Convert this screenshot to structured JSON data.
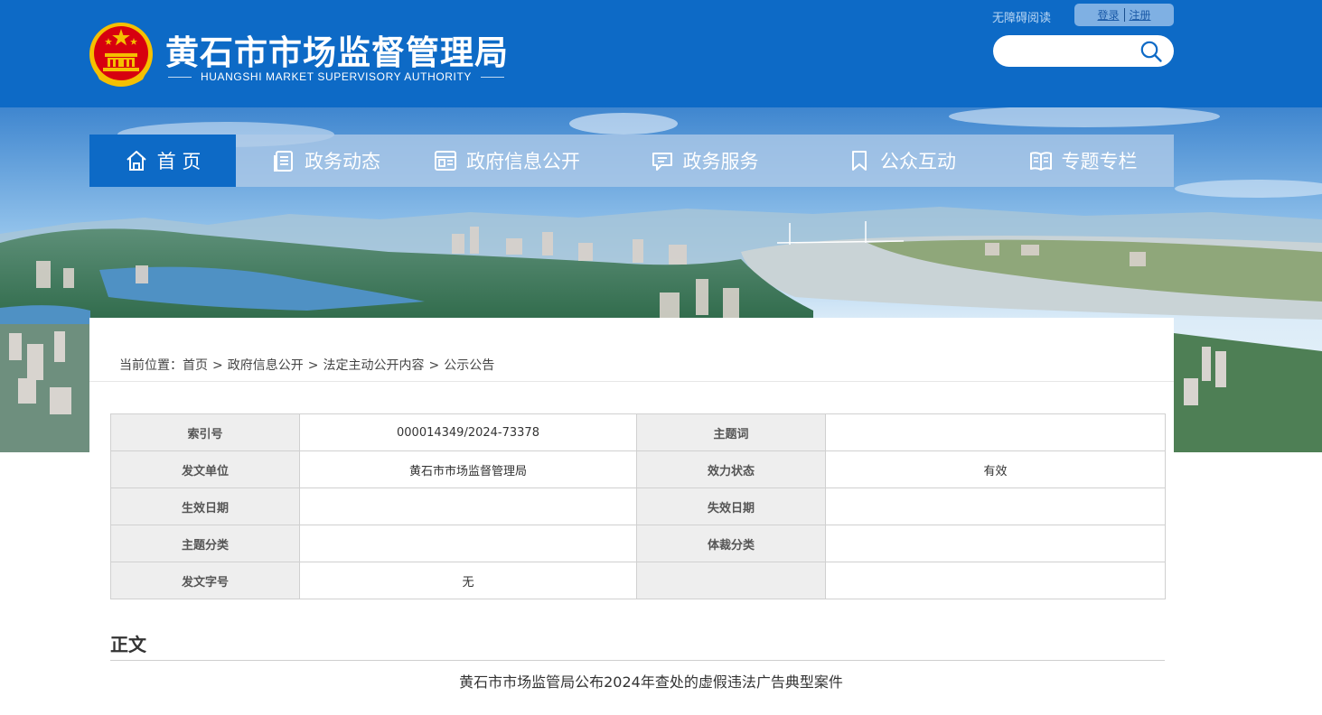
{
  "header": {
    "title": "黄石市市场监督管理局",
    "subtitle": "HUANGSHI MARKET SUPERVISORY AUTHORITY",
    "accessibility_label": "无障碍阅读",
    "login_label": "登录",
    "register_label": "注册",
    "search_placeholder": ""
  },
  "nav": {
    "items": [
      {
        "label": "首 页",
        "icon": "home-icon",
        "active": true
      },
      {
        "label": "政务动态",
        "icon": "document-list-icon"
      },
      {
        "label": "政府信息公开",
        "icon": "info-board-icon"
      },
      {
        "label": "政务服务",
        "icon": "chat-bubble-icon"
      },
      {
        "label": "公众互动",
        "icon": "bookmark-icon"
      },
      {
        "label": "专题专栏",
        "icon": "open-book-icon"
      }
    ]
  },
  "breadcrumb": {
    "prefix": "当前位置：",
    "items": [
      "首页",
      "政府信息公开",
      "法定主动公开内容",
      "公示公告"
    ],
    "separator": ">"
  },
  "meta_table": {
    "rows": [
      [
        {
          "label": "索引号",
          "value": "000014349/2024-73378"
        },
        {
          "label": "主题词",
          "value": ""
        }
      ],
      [
        {
          "label": "发文单位",
          "value": "黄石市市场监督管理局"
        },
        {
          "label": "效力状态",
          "value": "有效"
        }
      ],
      [
        {
          "label": "生效日期",
          "value": ""
        },
        {
          "label": "失效日期",
          "value": ""
        }
      ],
      [
        {
          "label": "主题分类",
          "value": ""
        },
        {
          "label": "体裁分类",
          "value": ""
        }
      ],
      [
        {
          "label": "发文字号",
          "value": "无"
        },
        {
          "label": "",
          "value": ""
        }
      ]
    ]
  },
  "content": {
    "section_title": "正文",
    "article_title": "黄石市市场监管局公布2024年查处的虚假违法广告典型案件"
  },
  "colors": {
    "brand_blue": "#0d6ac6",
    "nav_bg": "#afcae8",
    "table_label_bg": "#eeeeee",
    "emblem_red": "#d7000f",
    "emblem_gold": "#f5c000"
  }
}
